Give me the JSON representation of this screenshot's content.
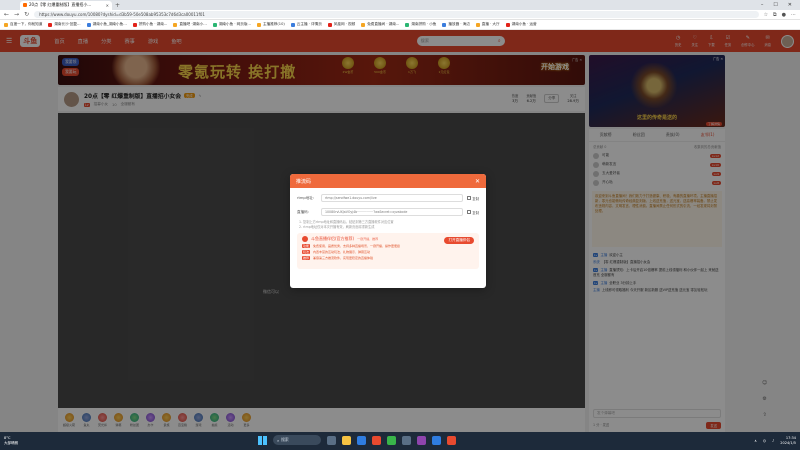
{
  "browser": {
    "tab_title": "20点【零 红爆重制版】直播招小…",
    "url": "https://www.douyu.com/10080?dyshid=d3b59-50e508ab95353c7d6d3ca00011f01",
    "bookmarks": [
      "百度一下，你就知道",
      "湖南长沙·回复…",
      "湖南小鱼_湖南小鱼…",
      "拼购小鱼 · 湖南…",
      "直播吧 ·湖南小…",
      "湖南小鱼 · 网页版…",
      "主播推荐(10)",
      "云主播 · 详情页",
      "凤凰网 · 视频",
      "免费直播间 · 湖南…",
      "湖南拼购 · 小鱼",
      "播放器 · 海边",
      "直播 · 大厅",
      "湖南小鱼 · 运营"
    ]
  },
  "site": {
    "logo": "斗鱼",
    "nav": [
      "首页",
      "直播",
      "分类",
      "赛事",
      "游戏",
      "鱼吧"
    ],
    "search_placeholder": "搜索",
    "nav_icons": [
      {
        "icon": "history-icon",
        "label": "历史"
      },
      {
        "icon": "follow-icon",
        "label": "关注"
      },
      {
        "icon": "download-icon",
        "label": "下载"
      },
      {
        "icon": "task-icon",
        "label": "任务"
      },
      {
        "icon": "create-icon",
        "label": "创作中心"
      },
      {
        "icon": "message-icon",
        "label": "消息"
      }
    ]
  },
  "banner": {
    "pill1": "我要领",
    "pill2": "我要玩",
    "slogan": "零氪玩转 挨打撤",
    "prizes": [
      "2W金币",
      "500金币",
      "1万飞",
      "1元红包"
    ],
    "cta": "开始游戏",
    "ad_tag": "广告 ✕"
  },
  "side_ad": {
    "caption": "这里的传奇是送的",
    "close": "广告 ✕",
    "detail": "了解详情"
  },
  "room": {
    "title": "20点【零 红爆重制版】直播招小女会",
    "level": "Lv",
    "host_name": "招募小女",
    "meta": "10",
    "category": "全服都有",
    "badge": "完成",
    "stats": [
      {
        "label": "热度",
        "value": "3万"
      },
      {
        "label": "贡献值",
        "value": "6.2万"
      },
      {
        "label": "关注",
        "value": "28.9万"
      }
    ],
    "follow_label": "分享"
  },
  "video": {
    "hint": "微信可以"
  },
  "gifts": [
    "超级火箭",
    "鱼丸",
    "荧光棒",
    "弹幕",
    "粉丝团",
    "办卡",
    "贵族",
    "百宝箱",
    "游戏",
    "抽奖",
    "活动",
    "更多"
  ],
  "right_panel": {
    "tabs": [
      "贡献榜",
      "粉丝团",
      "贵族(0)",
      "友邻(1)"
    ],
    "active_tab": 3,
    "rank_header_left": "总贡献 0",
    "rank_header_right": "收集到的总贡献值",
    "ranks": [
      {
        "name": "可能",
        "badge": "Lv12"
      },
      {
        "name": "萌新发言",
        "badge": "Lv10"
      },
      {
        "name": "五大爱好者",
        "badge": "Lv9"
      },
      {
        "name": "开心哒",
        "badge": "Lv8"
      }
    ],
    "notice": "欢迎来到斗鱼直播间！我们致力于打造健康、积极、有趣的直播环境。主播直播招新，零元也能畅玩传奇经典复刻版，上线送充值，送元宝，送高爆率装备。禁止发布违规内容，文明发言，理性消费。直播间禁止任何形式的引流，一经发现将封禁处理。",
    "chat": [
      {
        "name": "主播",
        "text": "欢迎小主"
      },
      {
        "name": "系统",
        "text": "【零 红爆重制版】直播招小女会"
      },
      {
        "name": "主播",
        "text": "直播须知：上卡后开启10倍爆率 提前上线领福利 和小伙伴一起上 来就送首充 全服都有"
      },
      {
        "name": "主播",
        "text": "全职业 3分钟上手"
      },
      {
        "name": "主播",
        "text": "上线即可领取福利 今天开服 新区新服 送VIP送充值 送元宝 零氪轻松玩"
      }
    ],
    "input_placeholder": "发个弹幕吧",
    "send_label": "发送",
    "send_hint": "1 分 · 发送"
  },
  "modal": {
    "title": "推流码",
    "rtmp_label": "rtmp地址:",
    "rtmp_value": "rtmp://sendfwe1.douyu.com/live",
    "code_label": "直播码:",
    "code_value": "10080rvUXJaVOyj4b················?wsSecret=xyzabcde",
    "copy": "复制",
    "tip1": "1. 复制上方rtmp地址和直播码后，粘贴到第三方直播软件对应位置",
    "tip2": "2. rtmp地址仅对本次开播有效，刷新页面将重新生成",
    "promo_title": "斗鱼直播伴侣(官方推荐)",
    "promo_sub": "一键开播，推荐",
    "promo_button": "打开直播伴侣",
    "promo_lines": [
      {
        "tag": "功能",
        "text": "免费使用，画质优秀，支持多种直播场景，一键开播，操作更便捷"
      },
      {
        "tag": "玩法",
        "text": "内置丰富的互动玩法，礼物展示、弹幕互动"
      },
      {
        "tag": "推荐",
        "text": "兼容第三方推流软件，实现更稳定的直播体验"
      }
    ]
  },
  "taskbar": {
    "temp": "8°C",
    "weather": "大部晴朗",
    "search": "搜索",
    "time": "17:34",
    "date": "2024/1/5"
  }
}
